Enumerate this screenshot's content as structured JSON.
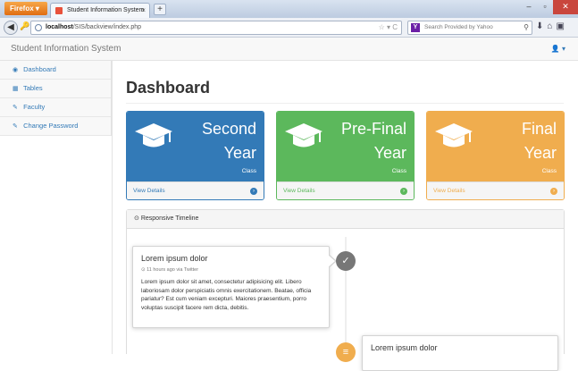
{
  "browser": {
    "menu_label": "Firefox",
    "tab_title": "Student Information System",
    "new_tab": "+",
    "url_prefix": "",
    "url_host": "localhost",
    "url_path": "/SIS/backview/index.php",
    "search_placeholder": "Search Provided by Yahoo",
    "search_engine_icon": "Y",
    "url_icons": "☆ ▾ C"
  },
  "app": {
    "brand": "Student Information System",
    "user_menu": "👤 ▾"
  },
  "sidebar": {
    "items": [
      {
        "icon": "dashboard-icon",
        "glyph": "◉",
        "label": "Dashboard"
      },
      {
        "icon": "table-icon",
        "glyph": "▦",
        "label": "Tables"
      },
      {
        "icon": "edit-icon",
        "glyph": "✎",
        "label": "Faculty"
      },
      {
        "icon": "edit-icon",
        "glyph": "✎",
        "label": "Change Password"
      }
    ]
  },
  "main": {
    "title": "Dashboard",
    "panels": [
      {
        "line1": "Second",
        "line2": "Year",
        "sub": "Class",
        "link": "View Details",
        "color": "#337ab7"
      },
      {
        "line1": "Pre-Final",
        "line2": "Year",
        "sub": "Class",
        "link": "View Details",
        "color": "#5cb85c"
      },
      {
        "line1": "Final",
        "line2": "Year",
        "sub": "Class",
        "link": "View Details",
        "color": "#f0ad4e"
      }
    ],
    "timeline": {
      "header": "Responsive Timeline",
      "entries": [
        {
          "title": "Lorem ipsum dolor",
          "meta": "11 hours ago via Twitter",
          "body": "Lorem ipsum dolor sit amet, consectetur adipisicing elit. Libero laboriosam dolor perspiciatis omnis exercitationem. Beatae, officia pariatur? Est cum veniam excepturi. Maiores praesentium, porro voluptas suscipit facere rem dicta, debitis.",
          "badge_glyph": "✓",
          "badge_color": "#777777"
        },
        {
          "title": "Lorem ipsum dolor",
          "badge_glyph": "≡",
          "badge_color": "#f0ad4e"
        }
      ]
    }
  }
}
